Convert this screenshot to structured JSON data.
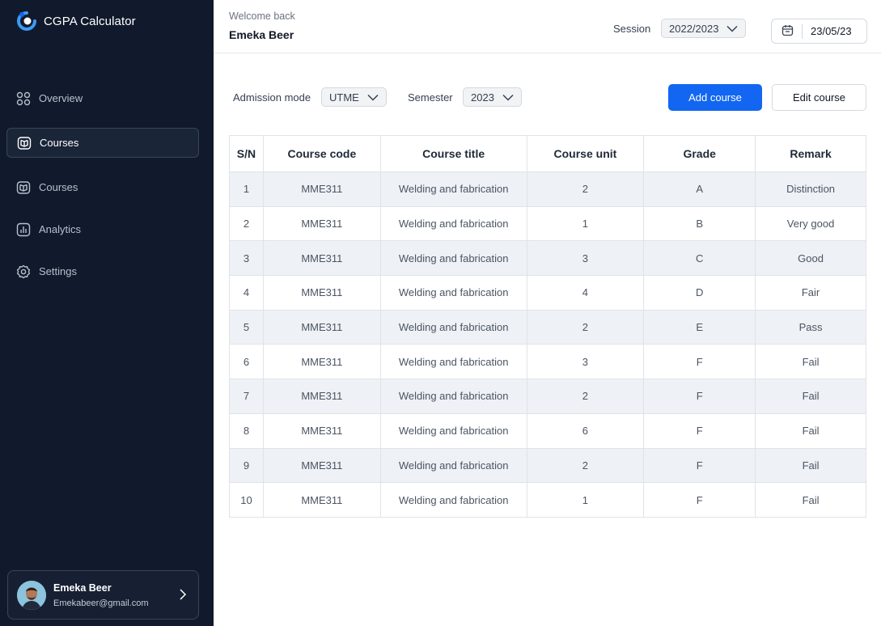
{
  "app": {
    "title": "CGPA Calculator",
    "brand_color": "#1266f1",
    "sidebar_bg": "#111a2c"
  },
  "sidebar": {
    "items": [
      {
        "label": "Overview",
        "icon": "grid-icon",
        "active": false
      },
      {
        "label": "Courses",
        "icon": "book-icon",
        "active": true
      },
      {
        "label": "Courses",
        "icon": "book-icon",
        "active": false
      },
      {
        "label": "Analytics",
        "icon": "chart-icon",
        "active": false
      },
      {
        "label": "Settings",
        "icon": "gear-icon",
        "active": false
      }
    ],
    "user": {
      "name": "Emeka Beer",
      "email": "Emekabeer@gmail.com"
    }
  },
  "header": {
    "welcome": "Welcome back",
    "username": "Emeka Beer",
    "session_label": "Session",
    "session_value": "2022/2023",
    "date": "23/05/23"
  },
  "controls": {
    "admission_label": "Admission mode",
    "admission_value": "UTME",
    "semester_label": "Semester",
    "semester_value": "2023",
    "add_label": "Add course",
    "edit_label": "Edit course"
  },
  "table": {
    "columns": [
      "S/N",
      "Course code",
      "Course title",
      "Course unit",
      "Grade",
      "Remark"
    ],
    "rows": [
      [
        "1",
        "MME311",
        "Welding and fabrication",
        "2",
        "A",
        "Distinction"
      ],
      [
        "2",
        "MME311",
        "Welding and fabrication",
        "1",
        "B",
        "Very good"
      ],
      [
        "3",
        "MME311",
        "Welding and fabrication",
        "3",
        "C",
        "Good"
      ],
      [
        "4",
        "MME311",
        "Welding and fabrication",
        "4",
        "D",
        "Fair"
      ],
      [
        "5",
        "MME311",
        "Welding and fabrication",
        "2",
        "E",
        "Pass"
      ],
      [
        "6",
        "MME311",
        "Welding and fabrication",
        "3",
        "F",
        "Fail"
      ],
      [
        "7",
        "MME311",
        "Welding and fabrication",
        "2",
        "F",
        "Fail"
      ],
      [
        "8",
        "MME311",
        "Welding and fabrication",
        "6",
        "F",
        "Fail"
      ],
      [
        "9",
        "MME311",
        "Welding and fabrication",
        "2",
        "F",
        "Fail"
      ],
      [
        "10",
        "MME311",
        "Welding and fabrication",
        "1",
        "F",
        "Fail"
      ]
    ]
  }
}
